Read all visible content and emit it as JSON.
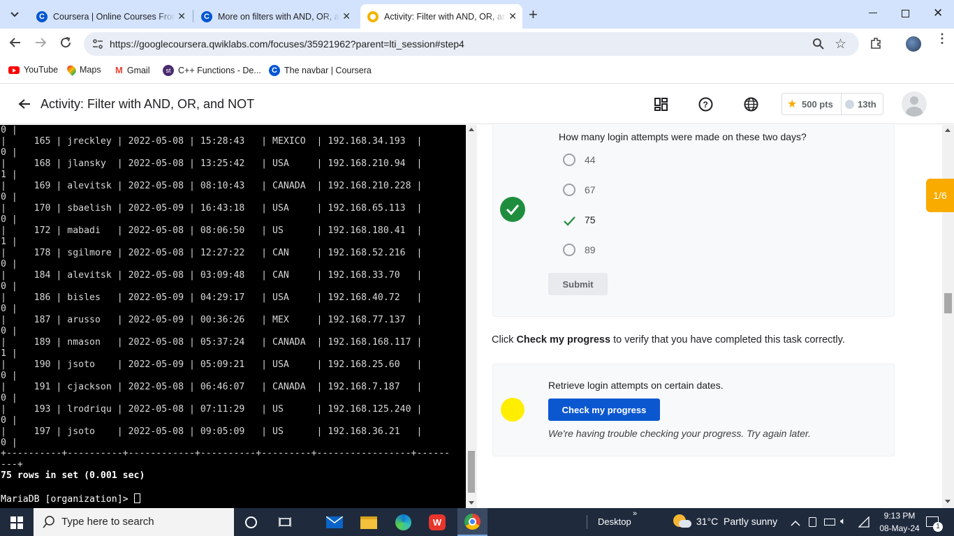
{
  "browser": {
    "tabs": [
      {
        "title": "Coursera | Online Courses From Top Universities",
        "favicon": "coursera-icon"
      },
      {
        "title": "More on filters with AND, OR, and NOT",
        "favicon": "coursera-icon"
      },
      {
        "title": "Activity: Filter with AND, OR, and NOT",
        "favicon": "qwiklabs-icon",
        "active": true
      }
    ],
    "new_tab": "+",
    "url": "https://googlecoursera.qwiklabs.com/focuses/35921962?parent=lti_session#step4",
    "bookmarks": [
      {
        "label": "YouTube",
        "icon": "youtube-icon"
      },
      {
        "label": "Maps",
        "icon": "maps-icon"
      },
      {
        "label": "Gmail",
        "icon": "gmail-icon"
      },
      {
        "label": "C++ Functions - De...",
        "icon": "studytonight-icon"
      },
      {
        "label": "The navbar | Coursera",
        "icon": "coursera-icon"
      }
    ]
  },
  "header": {
    "title": "Activity: Filter with AND, OR, and NOT",
    "points": "500 pts",
    "rank": "13th"
  },
  "terminal": {
    "first_line": "0 |",
    "rows": [
      {
        "id": "165",
        "user": "jreckley",
        "date": "2022-05-08",
        "time": "15:28:43",
        "country": "MEXICO",
        "ip": "192.168.34.193",
        "success": "0"
      },
      {
        "id": "168",
        "user": "jlansky",
        "date": "2022-05-08",
        "time": "13:25:42",
        "country": "USA",
        "ip": "192.168.210.94",
        "success": "1"
      },
      {
        "id": "169",
        "user": "alevitsk",
        "date": "2022-05-08",
        "time": "08:10:43",
        "country": "CANADA",
        "ip": "192.168.210.228",
        "success": "0"
      },
      {
        "id": "170",
        "user": "sbaelish",
        "date": "2022-05-09",
        "time": "16:43:18",
        "country": "USA",
        "ip": "192.168.65.113",
        "success": "0"
      },
      {
        "id": "172",
        "user": "mabadi",
        "date": "2022-05-08",
        "time": "08:06:50",
        "country": "US",
        "ip": "192.168.180.41",
        "success": "1"
      },
      {
        "id": "178",
        "user": "sgilmore",
        "date": "2022-05-08",
        "time": "12:27:22",
        "country": "CAN",
        "ip": "192.168.52.216",
        "success": "0"
      },
      {
        "id": "184",
        "user": "alevitsk",
        "date": "2022-05-08",
        "time": "03:09:48",
        "country": "CAN",
        "ip": "192.168.33.70",
        "success": "0"
      },
      {
        "id": "186",
        "user": "bisles",
        "date": "2022-05-09",
        "time": "04:29:17",
        "country": "USA",
        "ip": "192.168.40.72",
        "success": "0"
      },
      {
        "id": "187",
        "user": "arusso",
        "date": "2022-05-09",
        "time": "00:36:26",
        "country": "MEX",
        "ip": "192.168.77.137",
        "success": "0"
      },
      {
        "id": "189",
        "user": "nmason",
        "date": "2022-05-08",
        "time": "05:37:24",
        "country": "CANADA",
        "ip": "192.168.168.117",
        "success": "1"
      },
      {
        "id": "190",
        "user": "jsoto",
        "date": "2022-05-09",
        "time": "05:09:21",
        "country": "USA",
        "ip": "192.168.25.60",
        "success": "0"
      },
      {
        "id": "191",
        "user": "cjackson",
        "date": "2022-05-08",
        "time": "06:46:07",
        "country": "CANADA",
        "ip": "192.168.7.187",
        "success": "0"
      },
      {
        "id": "193",
        "user": "lrodriqu",
        "date": "2022-05-08",
        "time": "07:11:29",
        "country": "US",
        "ip": "192.168.125.240",
        "success": "0"
      },
      {
        "id": "197",
        "user": "jsoto",
        "date": "2022-05-08",
        "time": "09:05:09",
        "country": "US",
        "ip": "192.168.36.21",
        "success": "0"
      }
    ],
    "border_line": "+----------+----------+------------+----------+---------+-----------------+------",
    "border_cont": "---+",
    "result": "75 rows in set (0.001 sec)",
    "prompt": "MariaDB [organization]> "
  },
  "quiz": {
    "question": "How many login attempts were made on these two days?",
    "options": [
      "44",
      "67",
      "75",
      "89"
    ],
    "selected_index": 2,
    "submit": "Submit",
    "progress_label": "1/6"
  },
  "instructions": {
    "prefix": "Click",
    "bold": "Check my progress",
    "suffix": "to verify that you have completed this task correctly."
  },
  "progress_card": {
    "task": "Retrieve login attempts on certain dates.",
    "button": "Check my progress",
    "message": "We're having trouble checking your progress. Try again later."
  },
  "taskbar": {
    "search_placeholder": "Type here to search",
    "desktop": "Desktop",
    "weather": "31°C  Partly sunny",
    "time": "9:13 PM",
    "date": "08-May-24",
    "notif_count": "1"
  },
  "colors": {
    "accent": "#0b57d0",
    "check_green": "#1e8e3e",
    "status_yellow": "#ffee00",
    "tab_strip": "#d3e3fd",
    "progress_tab": "#f9ab00"
  }
}
